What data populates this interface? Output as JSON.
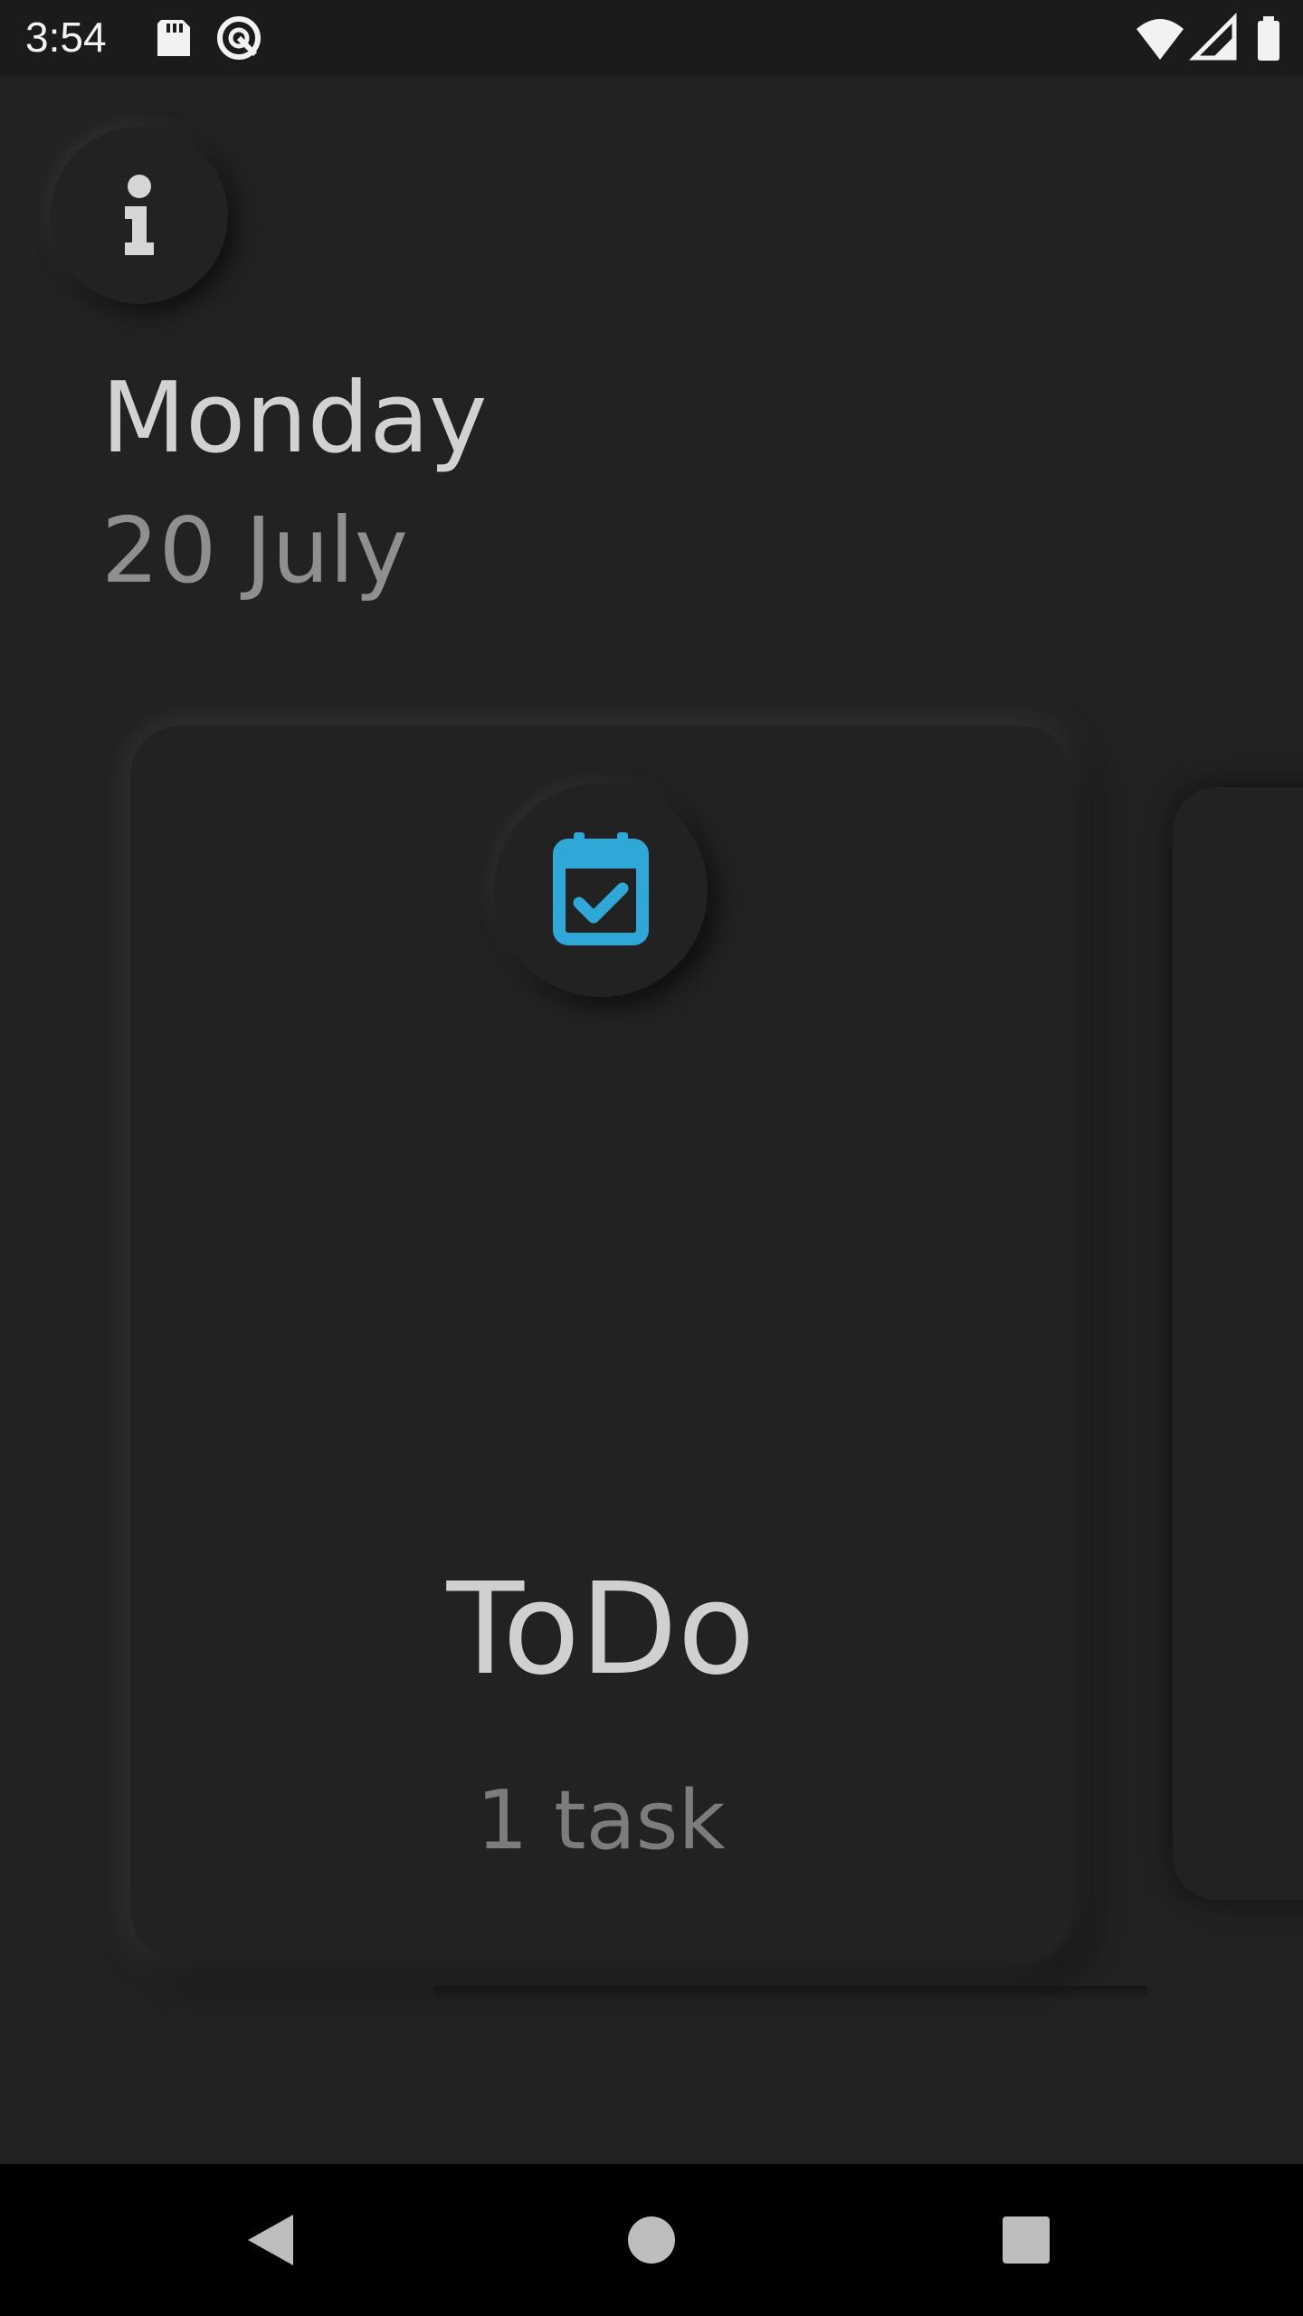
{
  "status_bar": {
    "time": "3:54",
    "icons": [
      "sd-card-icon",
      "data-saver-icon",
      "wifi-icon",
      "signal-icon",
      "battery-icon"
    ]
  },
  "header": {
    "info_icon": "info-icon",
    "day": "Monday",
    "date": "20 July"
  },
  "card": {
    "icon": "calendar-check-icon",
    "icon_color": "#2fa8d8",
    "title": "ToDo",
    "count": "1 task"
  },
  "nav_bar": {
    "buttons": [
      "back-icon",
      "home-icon",
      "recents-icon"
    ]
  },
  "colors": {
    "background": "#222222",
    "status_bar": "#1b1b1b",
    "nav_bar": "#000000",
    "accent": "#2fa8d8"
  }
}
